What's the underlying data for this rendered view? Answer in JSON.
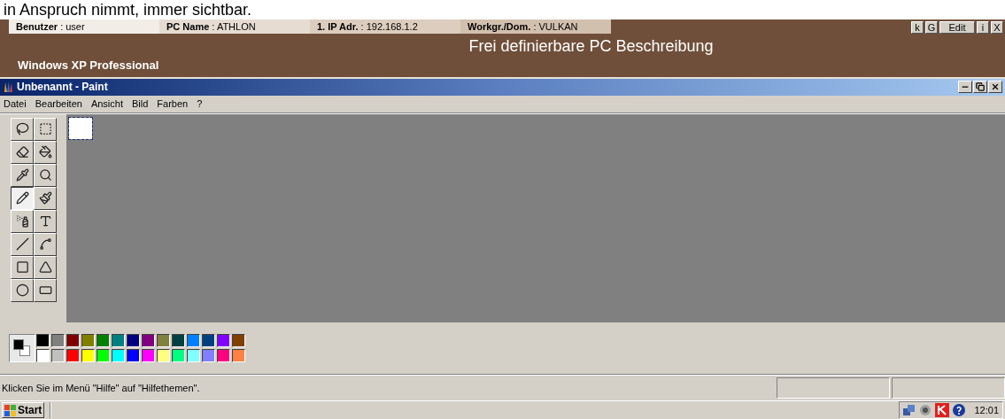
{
  "caption": "in Anspruch nimmt, immer sichtbar.",
  "info_bar": {
    "fields": [
      {
        "label": "Benutzer",
        "separator": ":",
        "value": "user"
      },
      {
        "label": "PC Name",
        "separator": ":",
        "value": "ATHLON"
      },
      {
        "label": "1. IP Adr.",
        "separator": ":",
        "value": "192.168.1.2"
      },
      {
        "label": "Workgr./Dom.",
        "separator": ":",
        "value": "VULKAN"
      }
    ],
    "buttons": [
      "k",
      "G",
      "Edit",
      "i",
      "X"
    ]
  },
  "banner": {
    "title": "Frei definierbare PC Beschreibung",
    "os": "Windows XP Professional"
  },
  "window": {
    "title": "Unbenannt - Paint"
  },
  "menu": [
    "Datei",
    "Bearbeiten",
    "Ansicht",
    "Bild",
    "Farben",
    "?"
  ],
  "tools": [
    {
      "selected": false
    },
    {
      "selected": false
    },
    {
      "selected": false
    },
    {
      "selected": false
    },
    {
      "selected": false
    },
    {
      "selected": false
    },
    {
      "selected": true
    },
    {
      "selected": false
    },
    {
      "selected": false
    },
    {
      "selected": false
    },
    {
      "selected": false
    },
    {
      "selected": false
    },
    {
      "selected": false
    },
    {
      "selected": false
    },
    {
      "selected": false
    },
    {
      "selected": false
    }
  ],
  "palette": {
    "foreground": {
      "color": "#000000"
    },
    "background": {
      "color": "#ffffff"
    },
    "top": [
      {
        "color": "#000000"
      },
      {
        "color": "#808080"
      },
      {
        "color": "#800000"
      },
      {
        "color": "#808000"
      },
      {
        "color": "#008000"
      },
      {
        "color": "#008080"
      },
      {
        "color": "#000080"
      },
      {
        "color": "#800080"
      },
      {
        "color": "#808040"
      },
      {
        "color": "#004040"
      },
      {
        "color": "#0080ff"
      },
      {
        "color": "#004080"
      },
      {
        "color": "#8000ff"
      },
      {
        "color": "#804000"
      }
    ],
    "bottom": [
      {
        "color": "#ffffff"
      },
      {
        "color": "#c0c0c0"
      },
      {
        "color": "#ff0000"
      },
      {
        "color": "#ffff00"
      },
      {
        "color": "#00ff00"
      },
      {
        "color": "#00ffff"
      },
      {
        "color": "#0000ff"
      },
      {
        "color": "#ff00ff"
      },
      {
        "color": "#ffff80"
      },
      {
        "color": "#00ff80"
      },
      {
        "color": "#80ffff"
      },
      {
        "color": "#8080ff"
      },
      {
        "color": "#ff0080"
      },
      {
        "color": "#ff8040"
      }
    ]
  },
  "status_bar": {
    "text": "Klicken Sie im Menü \"Hilfe\" auf \"Hilfethemen\"."
  },
  "taskbar": {
    "start": "Start",
    "clock": "12:01"
  }
}
